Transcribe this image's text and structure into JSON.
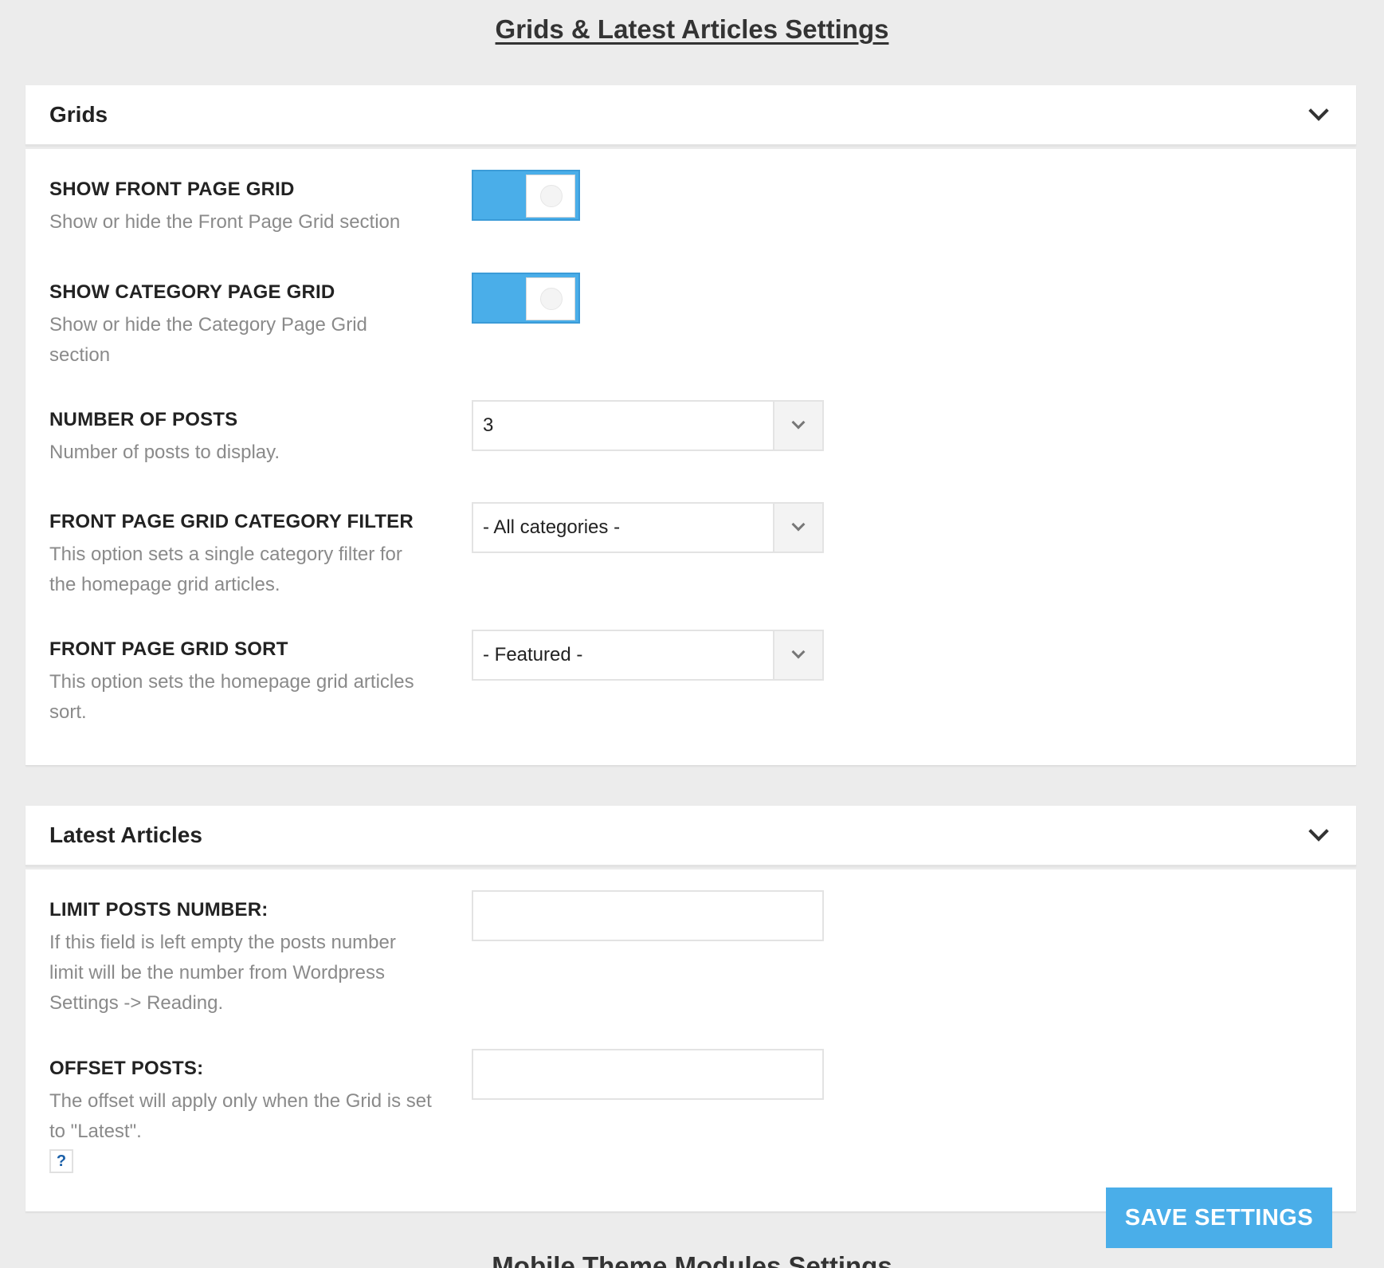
{
  "page_title": "Grids & Latest Articles Settings",
  "sections": {
    "grids": {
      "title": "Grids",
      "show_front_page_grid": {
        "label": "SHOW FRONT PAGE GRID",
        "desc": "Show or hide the Front Page Grid section",
        "enabled": true
      },
      "show_category_page_grid": {
        "label": "SHOW CATEGORY PAGE GRID",
        "desc": "Show or hide the Category Page Grid section",
        "enabled": true
      },
      "number_of_posts": {
        "label": "NUMBER OF POSTS",
        "desc": "Number of posts to display.",
        "value": "3"
      },
      "category_filter": {
        "label": "FRONT PAGE GRID CATEGORY FILTER",
        "desc": "This option sets a single category filter for the homepage grid articles.",
        "value": "- All categories -"
      },
      "grid_sort": {
        "label": "FRONT PAGE GRID SORT",
        "desc": "This option sets the homepage grid articles sort.",
        "value": "- Featured -"
      }
    },
    "latest_articles": {
      "title": "Latest Articles",
      "limit_posts": {
        "label": "LIMIT POSTS NUMBER:",
        "desc": "If this field is left empty the posts number limit will be the number from Wordpress Settings -> Reading.",
        "value": ""
      },
      "offset_posts": {
        "label": "OFFSET POSTS:",
        "desc": "The offset will apply only when the Grid is set to \"Latest\".",
        "value": "",
        "help": "?"
      }
    }
  },
  "save_label": "SAVE SETTINGS",
  "next_section_title": "Mobile Theme Modules Settings",
  "colors": {
    "accent": "#4aaee9",
    "background": "#ececec",
    "panel": "#ffffff",
    "description_text": "#8a8a8a"
  }
}
